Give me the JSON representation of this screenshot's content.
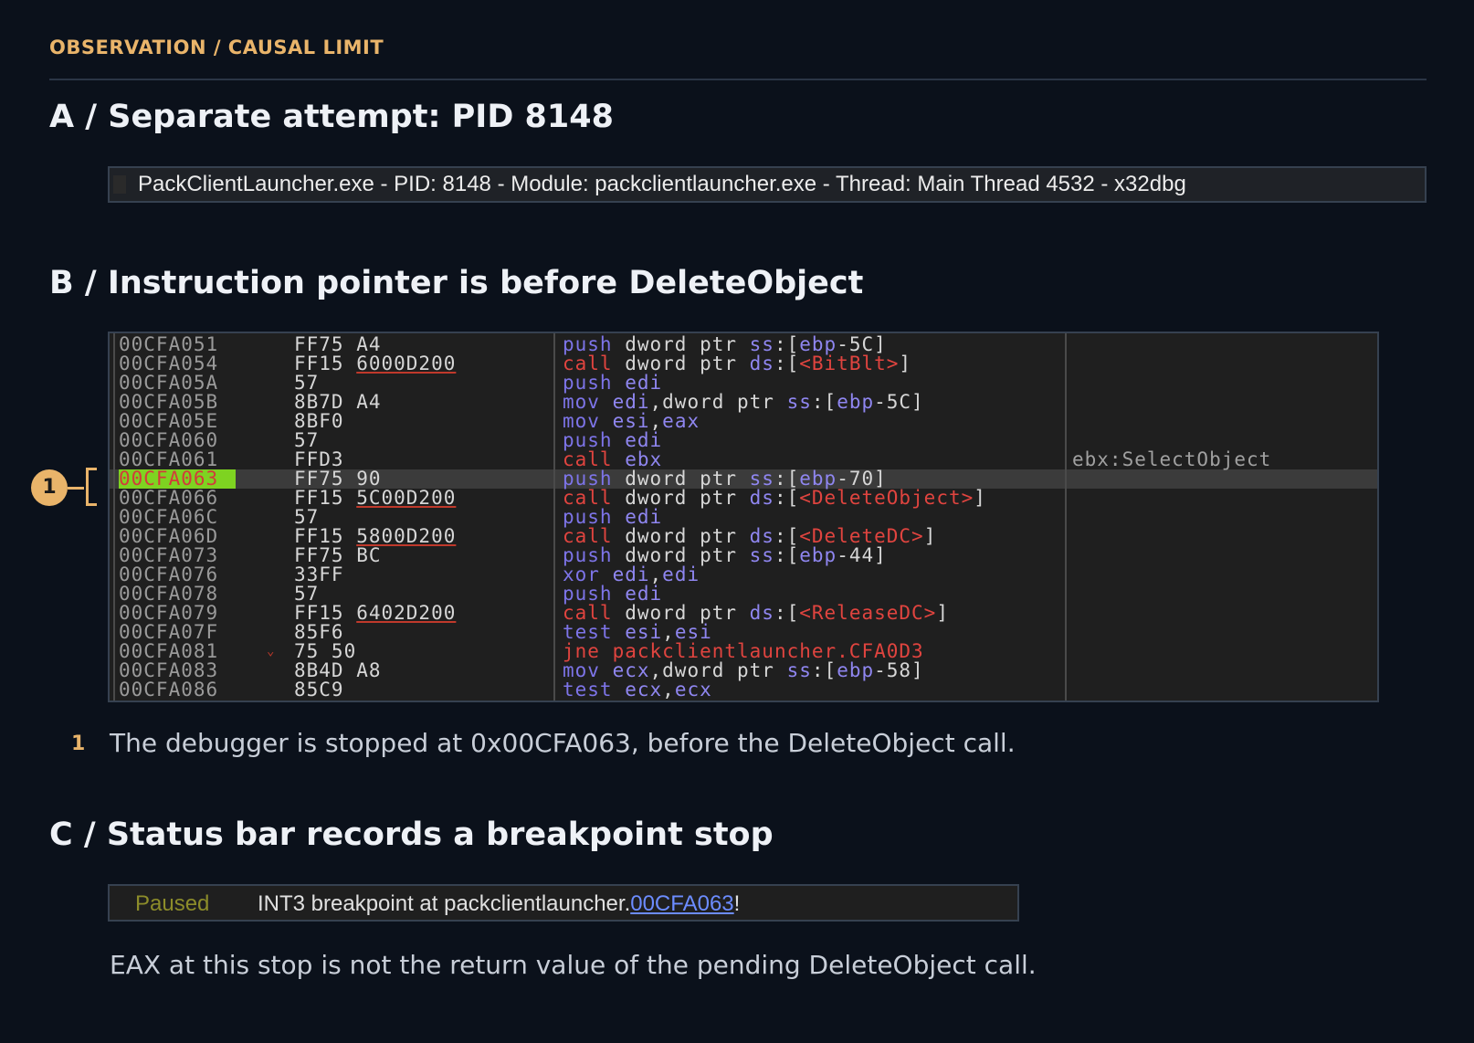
{
  "kicker": "OBSERVATION / CAUSAL LIMIT",
  "sections": {
    "a_title": "A / Separate attempt: PID 8148",
    "b_title": "B / Instruction pointer is before DeleteObject",
    "c_title": "C / Status bar records a breakpoint stop"
  },
  "window_title": "PackClientLauncher.exe - PID: 8148 - Module: packclientlauncher.exe - Thread: Main Thread 4532 - x32dbg",
  "disassembly": {
    "current_row": 7,
    "rows": [
      {
        "addr": "00CFA051",
        "bytes": "FF75 A4",
        "mnemonic": "push",
        "operands": "dword ptr ss:[ebp-5C]",
        "comment": ""
      },
      {
        "addr": "00CFA054",
        "bytes": "FF15 6000D200",
        "mnemonic": "call",
        "operands": "dword ptr ds:[<BitBlt>]",
        "comment": ""
      },
      {
        "addr": "00CFA05A",
        "bytes": "57",
        "mnemonic": "push",
        "operands": "edi",
        "comment": ""
      },
      {
        "addr": "00CFA05B",
        "bytes": "8B7D A4",
        "mnemonic": "mov",
        "operands": "edi,dword ptr ss:[ebp-5C]",
        "comment": ""
      },
      {
        "addr": "00CFA05E",
        "bytes": "8BF0",
        "mnemonic": "mov",
        "operands": "esi,eax",
        "comment": ""
      },
      {
        "addr": "00CFA060",
        "bytes": "57",
        "mnemonic": "push",
        "operands": "edi",
        "comment": ""
      },
      {
        "addr": "00CFA061",
        "bytes": "FFD3",
        "mnemonic": "call",
        "operands": "ebx",
        "comment": "ebx:SelectObject"
      },
      {
        "addr": "00CFA063",
        "bytes": "FF75 90",
        "mnemonic": "push",
        "operands": "dword ptr ss:[ebp-70]",
        "comment": ""
      },
      {
        "addr": "00CFA066",
        "bytes": "FF15 5C00D200",
        "mnemonic": "call",
        "operands": "dword ptr ds:[<DeleteObject>]",
        "comment": ""
      },
      {
        "addr": "00CFA06C",
        "bytes": "57",
        "mnemonic": "push",
        "operands": "edi",
        "comment": ""
      },
      {
        "addr": "00CFA06D",
        "bytes": "FF15 5800D200",
        "mnemonic": "call",
        "operands": "dword ptr ds:[<DeleteDC>]",
        "comment": ""
      },
      {
        "addr": "00CFA073",
        "bytes": "FF75 BC",
        "mnemonic": "push",
        "operands": "dword ptr ss:[ebp-44]",
        "comment": ""
      },
      {
        "addr": "00CFA076",
        "bytes": "33FF",
        "mnemonic": "xor",
        "operands": "edi,edi",
        "comment": ""
      },
      {
        "addr": "00CFA078",
        "bytes": "57",
        "mnemonic": "push",
        "operands": "edi",
        "comment": ""
      },
      {
        "addr": "00CFA079",
        "bytes": "FF15 6402D200",
        "mnemonic": "call",
        "operands": "dword ptr ds:[<ReleaseDC>]",
        "comment": ""
      },
      {
        "addr": "00CFA07F",
        "bytes": "85F6",
        "mnemonic": "test",
        "operands": "esi,esi",
        "comment": ""
      },
      {
        "addr": "00CFA081",
        "bytes": "75 50",
        "mnemonic": "jne",
        "operands": "packclientlauncher.CFA0D3",
        "comment": ""
      },
      {
        "addr": "00CFA083",
        "bytes": "8B4D A8",
        "mnemonic": "mov",
        "operands": "ecx,dword ptr ss:[ebp-58]",
        "comment": ""
      },
      {
        "addr": "00CFA086",
        "bytes": "85C9",
        "mnemonic": "test",
        "operands": "ecx,ecx",
        "comment": ""
      }
    ]
  },
  "marker": {
    "number": "1"
  },
  "note": {
    "number": "1",
    "text": "The debugger is stopped at 0x00CFA063, before the DeleteObject call."
  },
  "status": {
    "state": "Paused",
    "message_prefix": "INT3 breakpoint at packclientlauncher.",
    "address_link": "00CFA063",
    "message_suffix": "!"
  },
  "footer_text": "EAX at this stop is not the return value of the pending DeleteObject call.",
  "colors": {
    "background": "#0b111b",
    "accent": "#e9b46a",
    "current_address_bg": "#7ed321",
    "api_red": "#e0443f",
    "register_purple": "#8f86f0",
    "status_paused": "#8c8c2a"
  }
}
